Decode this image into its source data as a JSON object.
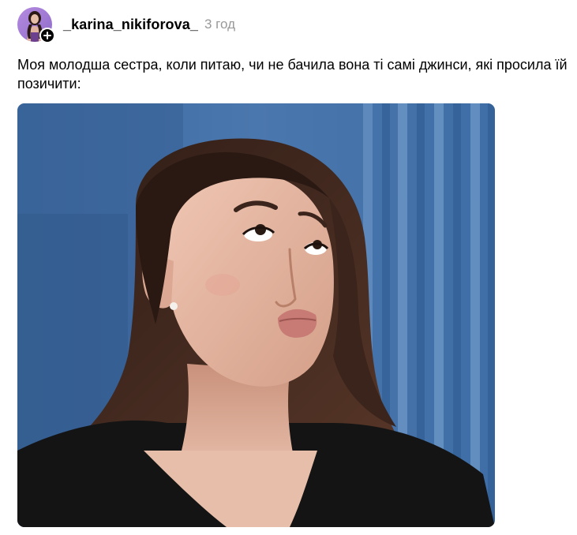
{
  "post": {
    "author": {
      "username": "_karina_nikiforova_",
      "avatar_icon": "profile-avatar",
      "follow_icon": "plus-icon"
    },
    "timestamp": "3 год",
    "caption": "Моя молодша сестра, коли питаю, чи не бачила вона ті самі джинси, які просила їй позичити:",
    "media": {
      "kind": "photo",
      "subject": "woman-looking-up-meme"
    }
  },
  "colors": {
    "username": "#000000",
    "timestamp": "#999999",
    "background_blue": "#3f6da3",
    "hair": "#3a241c",
    "skin": "#e2b49f",
    "top": "#141414"
  }
}
